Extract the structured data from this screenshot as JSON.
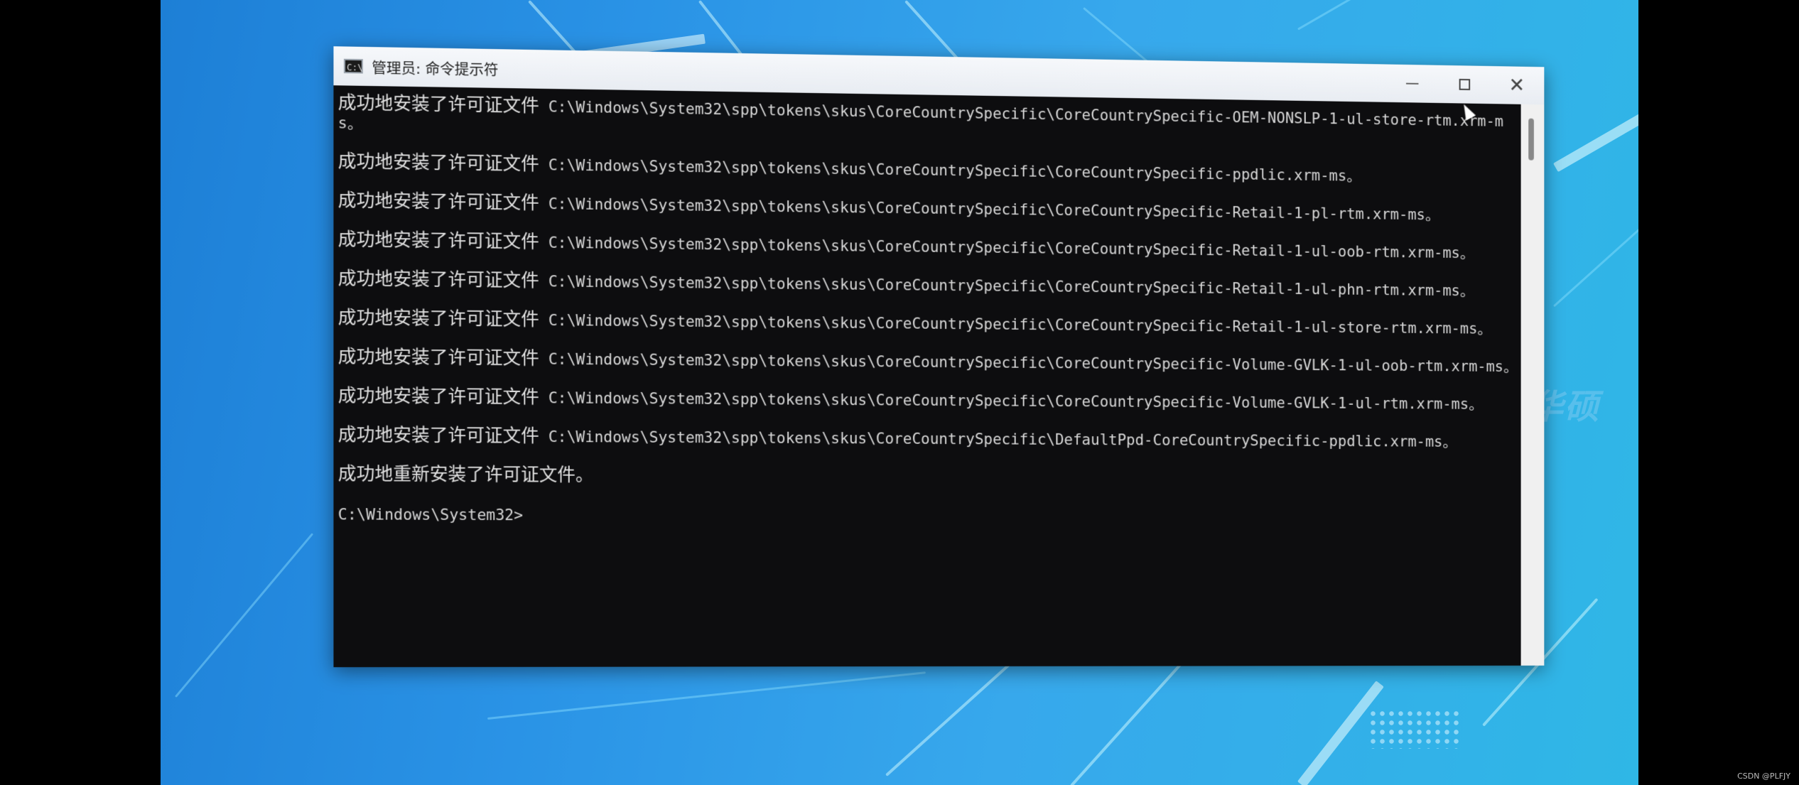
{
  "window": {
    "title": "管理员: 命令提示符",
    "icon": "cmd-icon",
    "controls": [
      "minimize-icon",
      "maximize-icon",
      "close-icon"
    ]
  },
  "console": {
    "entries": [
      {
        "prefix": "成功地安装了许可证文件",
        "path": "C:\\Windows\\System32\\spp\\tokens\\skus\\CoreCountrySpecific\\CoreCountrySpecific-OEM-NONSLP-1-ul-store-rtm.xrm-ms。"
      },
      {
        "prefix": "成功地安装了许可证文件",
        "path": "C:\\Windows\\System32\\spp\\tokens\\skus\\CoreCountrySpecific\\CoreCountrySpecific-ppdlic.xrm-ms。"
      },
      {
        "prefix": "成功地安装了许可证文件",
        "path": "C:\\Windows\\System32\\spp\\tokens\\skus\\CoreCountrySpecific\\CoreCountrySpecific-Retail-1-pl-rtm.xrm-ms。"
      },
      {
        "prefix": "成功地安装了许可证文件",
        "path": "C:\\Windows\\System32\\spp\\tokens\\skus\\CoreCountrySpecific\\CoreCountrySpecific-Retail-1-ul-oob-rtm.xrm-ms。"
      },
      {
        "prefix": "成功地安装了许可证文件",
        "path": "C:\\Windows\\System32\\spp\\tokens\\skus\\CoreCountrySpecific\\CoreCountrySpecific-Retail-1-ul-phn-rtm.xrm-ms。"
      },
      {
        "prefix": "成功地安装了许可证文件",
        "path": "C:\\Windows\\System32\\spp\\tokens\\skus\\CoreCountrySpecific\\CoreCountrySpecific-Retail-1-ul-store-rtm.xrm-ms。"
      },
      {
        "prefix": "成功地安装了许可证文件",
        "path": "C:\\Windows\\System32\\spp\\tokens\\skus\\CoreCountrySpecific\\CoreCountrySpecific-Volume-GVLK-1-ul-oob-rtm.xrm-ms。"
      },
      {
        "prefix": "成功地安装了许可证文件",
        "path": "C:\\Windows\\System32\\spp\\tokens\\skus\\CoreCountrySpecific\\CoreCountrySpecific-Volume-GVLK-1-ul-rtm.xrm-ms。"
      },
      {
        "prefix": "成功地安装了许可证文件",
        "path": "C:\\Windows\\System32\\spp\\tokens\\skus\\CoreCountrySpecific\\DefaultPpd-CoreCountrySpecific-ppdlic.xrm-ms。"
      }
    ],
    "summary": "成功地重新安装了许可证文件。",
    "prompt": "C:\\Windows\\System32>"
  },
  "background": {
    "brand_text": "华硕"
  },
  "watermark": "CSDN @PLFJY"
}
